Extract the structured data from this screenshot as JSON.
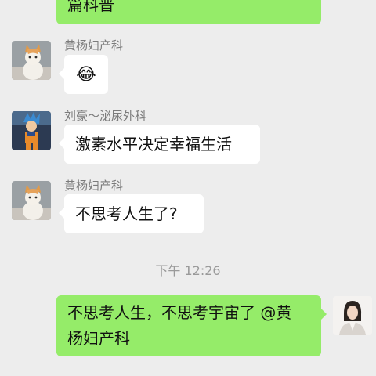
{
  "messages": [
    {
      "sender": "",
      "text": "篇科普"
    },
    {
      "sender": "黄杨妇产科",
      "text": "😂",
      "avatar": "cat-avatar"
    },
    {
      "sender": "刘豪～泌尿外科",
      "text": "激素水平决定幸福生活",
      "avatar": "anime-figure-avatar"
    },
    {
      "sender": "黄杨妇产科",
      "text": "不思考人生了?",
      "avatar": "cat-avatar"
    },
    {
      "sender": "",
      "text": "不思考人生，不思考宇宙了 @黄杨妇产科",
      "line1": "不思考人生，不思考宇宙了 @黄",
      "line2": "杨妇产科",
      "avatar": "woman-avatar"
    }
  ],
  "time_divider": "下午 12:26",
  "colors": {
    "background": "#ededed",
    "incoming_bubble": "#ffffff",
    "outgoing_bubble": "#95ec69",
    "meta_text": "#7b7b7b"
  }
}
